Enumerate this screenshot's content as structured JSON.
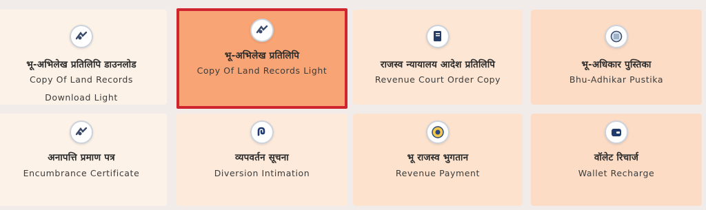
{
  "services": [
    {
      "hindi": "भू-अभिलेख प्रतिलिपि डाउनलोड",
      "english": "Copy Of Land Records Download Light",
      "icon": "land-records-icon",
      "bg": "#fdf2e7",
      "selected": false
    },
    {
      "hindi": "भू-अभिलेख प्रतिलिपि",
      "english": "Copy Of Land Records Light",
      "icon": "land-records-icon",
      "bg": "#f8a474",
      "selected": true
    },
    {
      "hindi": "राजस्व न्यायालय आदेश प्रतिलिपि",
      "english": "Revenue Court Order Copy",
      "icon": "court-order-icon",
      "bg": "#fde6d3",
      "selected": false
    },
    {
      "hindi": "भू-अधिकार पुस्तिका",
      "english": "Bhu-Adhikar Pustika",
      "icon": "book-icon",
      "bg": "#fcdcc5",
      "selected": false
    },
    {
      "hindi": "अनापत्ति प्रमाण पत्र",
      "english": "Encumbrance Certificate",
      "icon": "certificate-icon",
      "bg": "#fdf2e7",
      "selected": false
    },
    {
      "hindi": "व्यपवर्तन सूचना",
      "english": "Diversion Intimation",
      "icon": "diversion-icon",
      "bg": "#fdeadb",
      "selected": false
    },
    {
      "hindi": "भू राजस्व भुगतान",
      "english": "Revenue Payment",
      "icon": "payment-icon",
      "bg": "#fde3cd",
      "selected": false
    },
    {
      "hindi": "वॉलेट रिचार्ज",
      "english": "Wallet Recharge",
      "icon": "wallet-icon",
      "bg": "#fcdcc5",
      "selected": false
    }
  ]
}
